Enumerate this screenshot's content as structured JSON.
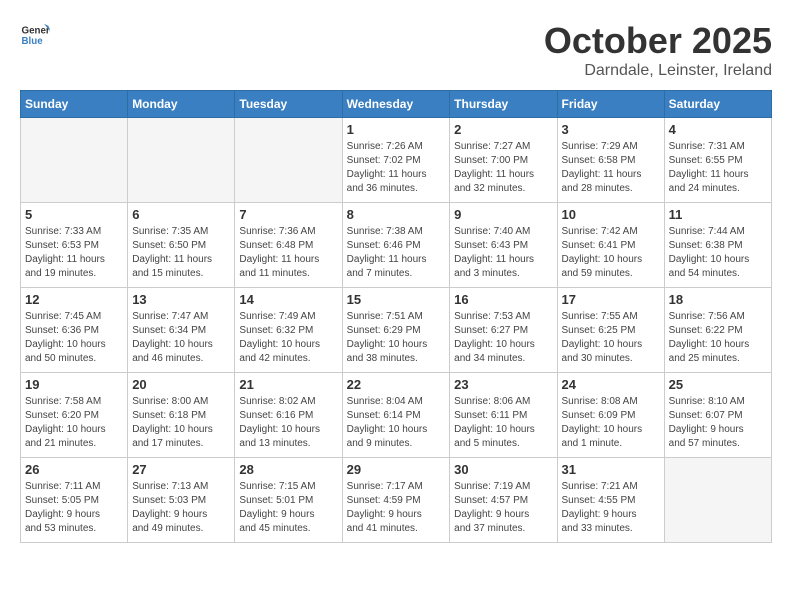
{
  "header": {
    "logo_general": "General",
    "logo_blue": "Blue",
    "month": "October 2025",
    "location": "Darndale, Leinster, Ireland"
  },
  "weekdays": [
    "Sunday",
    "Monday",
    "Tuesday",
    "Wednesday",
    "Thursday",
    "Friday",
    "Saturday"
  ],
  "weeks": [
    [
      {
        "day": "",
        "info": ""
      },
      {
        "day": "",
        "info": ""
      },
      {
        "day": "",
        "info": ""
      },
      {
        "day": "1",
        "info": "Sunrise: 7:26 AM\nSunset: 7:02 PM\nDaylight: 11 hours\nand 36 minutes."
      },
      {
        "day": "2",
        "info": "Sunrise: 7:27 AM\nSunset: 7:00 PM\nDaylight: 11 hours\nand 32 minutes."
      },
      {
        "day": "3",
        "info": "Sunrise: 7:29 AM\nSunset: 6:58 PM\nDaylight: 11 hours\nand 28 minutes."
      },
      {
        "day": "4",
        "info": "Sunrise: 7:31 AM\nSunset: 6:55 PM\nDaylight: 11 hours\nand 24 minutes."
      }
    ],
    [
      {
        "day": "5",
        "info": "Sunrise: 7:33 AM\nSunset: 6:53 PM\nDaylight: 11 hours\nand 19 minutes."
      },
      {
        "day": "6",
        "info": "Sunrise: 7:35 AM\nSunset: 6:50 PM\nDaylight: 11 hours\nand 15 minutes."
      },
      {
        "day": "7",
        "info": "Sunrise: 7:36 AM\nSunset: 6:48 PM\nDaylight: 11 hours\nand 11 minutes."
      },
      {
        "day": "8",
        "info": "Sunrise: 7:38 AM\nSunset: 6:46 PM\nDaylight: 11 hours\nand 7 minutes."
      },
      {
        "day": "9",
        "info": "Sunrise: 7:40 AM\nSunset: 6:43 PM\nDaylight: 11 hours\nand 3 minutes."
      },
      {
        "day": "10",
        "info": "Sunrise: 7:42 AM\nSunset: 6:41 PM\nDaylight: 10 hours\nand 59 minutes."
      },
      {
        "day": "11",
        "info": "Sunrise: 7:44 AM\nSunset: 6:38 PM\nDaylight: 10 hours\nand 54 minutes."
      }
    ],
    [
      {
        "day": "12",
        "info": "Sunrise: 7:45 AM\nSunset: 6:36 PM\nDaylight: 10 hours\nand 50 minutes."
      },
      {
        "day": "13",
        "info": "Sunrise: 7:47 AM\nSunset: 6:34 PM\nDaylight: 10 hours\nand 46 minutes."
      },
      {
        "day": "14",
        "info": "Sunrise: 7:49 AM\nSunset: 6:32 PM\nDaylight: 10 hours\nand 42 minutes."
      },
      {
        "day": "15",
        "info": "Sunrise: 7:51 AM\nSunset: 6:29 PM\nDaylight: 10 hours\nand 38 minutes."
      },
      {
        "day": "16",
        "info": "Sunrise: 7:53 AM\nSunset: 6:27 PM\nDaylight: 10 hours\nand 34 minutes."
      },
      {
        "day": "17",
        "info": "Sunrise: 7:55 AM\nSunset: 6:25 PM\nDaylight: 10 hours\nand 30 minutes."
      },
      {
        "day": "18",
        "info": "Sunrise: 7:56 AM\nSunset: 6:22 PM\nDaylight: 10 hours\nand 25 minutes."
      }
    ],
    [
      {
        "day": "19",
        "info": "Sunrise: 7:58 AM\nSunset: 6:20 PM\nDaylight: 10 hours\nand 21 minutes."
      },
      {
        "day": "20",
        "info": "Sunrise: 8:00 AM\nSunset: 6:18 PM\nDaylight: 10 hours\nand 17 minutes."
      },
      {
        "day": "21",
        "info": "Sunrise: 8:02 AM\nSunset: 6:16 PM\nDaylight: 10 hours\nand 13 minutes."
      },
      {
        "day": "22",
        "info": "Sunrise: 8:04 AM\nSunset: 6:14 PM\nDaylight: 10 hours\nand 9 minutes."
      },
      {
        "day": "23",
        "info": "Sunrise: 8:06 AM\nSunset: 6:11 PM\nDaylight: 10 hours\nand 5 minutes."
      },
      {
        "day": "24",
        "info": "Sunrise: 8:08 AM\nSunset: 6:09 PM\nDaylight: 10 hours\nand 1 minute."
      },
      {
        "day": "25",
        "info": "Sunrise: 8:10 AM\nSunset: 6:07 PM\nDaylight: 9 hours\nand 57 minutes."
      }
    ],
    [
      {
        "day": "26",
        "info": "Sunrise: 7:11 AM\nSunset: 5:05 PM\nDaylight: 9 hours\nand 53 minutes."
      },
      {
        "day": "27",
        "info": "Sunrise: 7:13 AM\nSunset: 5:03 PM\nDaylight: 9 hours\nand 49 minutes."
      },
      {
        "day": "28",
        "info": "Sunrise: 7:15 AM\nSunset: 5:01 PM\nDaylight: 9 hours\nand 45 minutes."
      },
      {
        "day": "29",
        "info": "Sunrise: 7:17 AM\nSunset: 4:59 PM\nDaylight: 9 hours\nand 41 minutes."
      },
      {
        "day": "30",
        "info": "Sunrise: 7:19 AM\nSunset: 4:57 PM\nDaylight: 9 hours\nand 37 minutes."
      },
      {
        "day": "31",
        "info": "Sunrise: 7:21 AM\nSunset: 4:55 PM\nDaylight: 9 hours\nand 33 minutes."
      },
      {
        "day": "",
        "info": ""
      }
    ]
  ]
}
